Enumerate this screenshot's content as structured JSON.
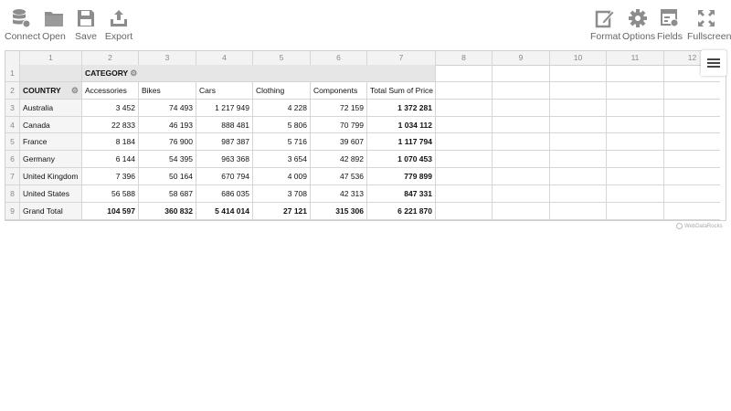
{
  "toolbar": {
    "left": [
      {
        "label": "Connect",
        "icon": "database-icon"
      },
      {
        "label": "Open",
        "icon": "folder-icon"
      },
      {
        "label": "Save",
        "icon": "floppy-icon"
      },
      {
        "label": "Export",
        "icon": "export-icon"
      }
    ],
    "right": [
      {
        "label": "Format",
        "icon": "edit-icon"
      },
      {
        "label": "Options",
        "icon": "gear-icon"
      },
      {
        "label": "Fields",
        "icon": "fields-icon"
      },
      {
        "label": "Fullscreen",
        "icon": "fullscreen-icon"
      }
    ]
  },
  "grid": {
    "column_numbers": [
      "1",
      "2",
      "3",
      "4",
      "5",
      "6",
      "7",
      "8",
      "9",
      "10",
      "11",
      "12"
    ],
    "row_numbers": [
      "1",
      "2",
      "3",
      "4",
      "5",
      "6",
      "7",
      "8",
      "9"
    ],
    "category_label": "CATEGORY",
    "country_label": "COUNTRY",
    "columns": [
      "Accessories",
      "Bikes",
      "Cars",
      "Clothing",
      "Components",
      "Total Sum of Price"
    ],
    "rows": [
      {
        "country": "Australia",
        "values": [
          "3 452",
          "74 493",
          "1 217 949",
          "4 228",
          "72 159",
          "1 372 281"
        ]
      },
      {
        "country": "Canada",
        "values": [
          "22 833",
          "46 193",
          "888 481",
          "5 806",
          "70 799",
          "1 034 112"
        ]
      },
      {
        "country": "France",
        "values": [
          "8 184",
          "76 900",
          "987 387",
          "5 716",
          "39 607",
          "1 117 794"
        ]
      },
      {
        "country": "Germany",
        "values": [
          "6 144",
          "54 395",
          "963 368",
          "3 654",
          "42 892",
          "1 070 453"
        ]
      },
      {
        "country": "United Kingdom",
        "values": [
          "7 396",
          "50 164",
          "670 794",
          "4 009",
          "47 536",
          "779 899"
        ]
      },
      {
        "country": "United States",
        "values": [
          "56 588",
          "58 687",
          "686 035",
          "3 708",
          "42 313",
          "847 331"
        ]
      }
    ],
    "grand_total": {
      "label": "Grand Total",
      "values": [
        "104 597",
        "360 832",
        "5 414 014",
        "27 121",
        "315 306",
        "6 221 870"
      ]
    }
  },
  "credit": "WebDataRocks",
  "colors": {
    "icon": "#8d8d8d",
    "label": "#666666",
    "header_bg": "#e6e6e6",
    "gridline": "#d6d6d6"
  }
}
